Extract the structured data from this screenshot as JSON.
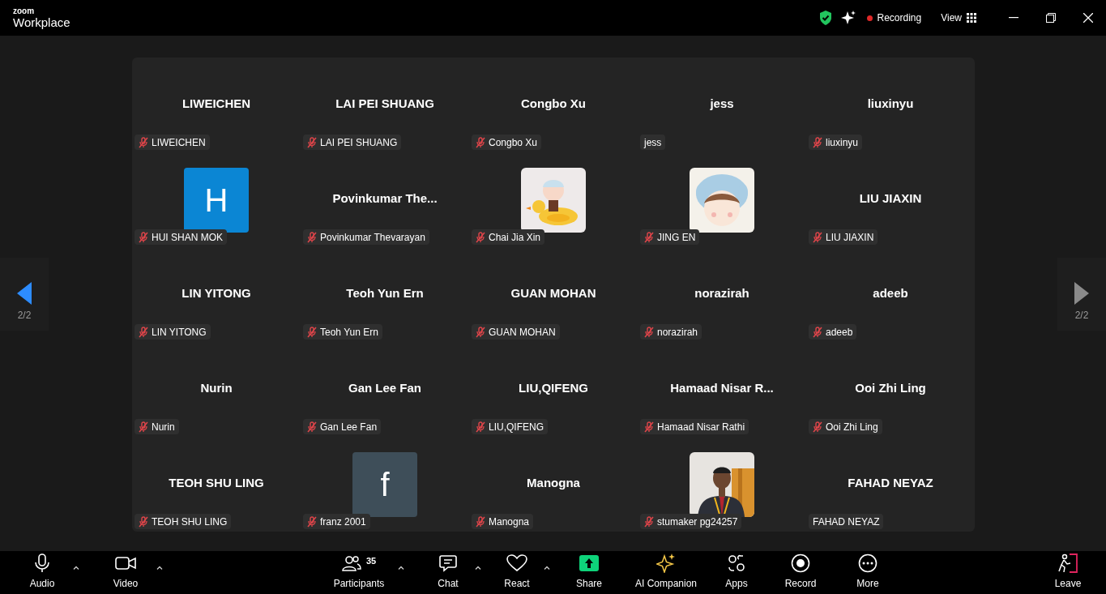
{
  "app": {
    "logo_top": "zoom",
    "logo_bottom": "Workplace"
  },
  "top_bar": {
    "recording": "Recording",
    "view": "View"
  },
  "pager": {
    "left": "2/2",
    "right": "2/2"
  },
  "tiles": [
    {
      "kind": "name",
      "name": "LIWEICHEN",
      "label": "LIWEICHEN",
      "muted": true
    },
    {
      "kind": "name",
      "name": "LAI PEI SHUANG",
      "label": "LAI PEI SHUANG",
      "muted": true
    },
    {
      "kind": "name",
      "name": "Congbo Xu",
      "label": "Congbo Xu",
      "muted": true
    },
    {
      "kind": "name",
      "name": "jess",
      "label": "jess",
      "muted": false
    },
    {
      "kind": "name",
      "name": "liuxinyu",
      "label": "liuxinyu",
      "muted": true
    },
    {
      "kind": "letter",
      "letter": "H",
      "color": "#0b86d4",
      "label": "HUI SHAN MOK",
      "muted": true
    },
    {
      "kind": "name",
      "name": "Povinkumar  The...",
      "label": "Povinkumar Thevarayan",
      "muted": true
    },
    {
      "kind": "picture",
      "label": "Chai Jia Xin",
      "muted": true
    },
    {
      "kind": "picture",
      "label": "JING EN",
      "muted": true
    },
    {
      "kind": "name",
      "name": "LIU JIAXIN",
      "label": "LIU JIAXIN",
      "muted": true
    },
    {
      "kind": "name",
      "name": "LIN YITONG",
      "label": "LIN YITONG",
      "muted": true
    },
    {
      "kind": "name",
      "name": "Teoh Yun Ern",
      "label": "Teoh Yun Ern",
      "muted": true
    },
    {
      "kind": "name",
      "name": "GUAN MOHAN",
      "label": "GUAN MOHAN",
      "muted": true
    },
    {
      "kind": "name",
      "name": "norazirah",
      "label": "norazirah",
      "muted": true
    },
    {
      "kind": "name",
      "name": "adeeb",
      "label": "adeeb",
      "muted": true
    },
    {
      "kind": "name",
      "name": "Nurin",
      "label": "Nurin",
      "muted": true
    },
    {
      "kind": "name",
      "name": "Gan Lee Fan",
      "label": "Gan Lee Fan",
      "muted": true
    },
    {
      "kind": "name",
      "name": "LIU,QIFENG",
      "label": "LIU,QIFENG",
      "muted": true
    },
    {
      "kind": "name",
      "name": "Hamaad  Nisar  R...",
      "label": "Hamaad Nisar Rathi",
      "muted": true
    },
    {
      "kind": "name",
      "name": "Ooi Zhi Ling",
      "label": "Ooi Zhi Ling",
      "muted": true
    },
    {
      "kind": "name",
      "name": "TEOH SHU LING",
      "label": "TEOH SHU LING",
      "muted": true
    },
    {
      "kind": "letter",
      "letter": "f",
      "color": "#3e4e59",
      "label": "franz 2001",
      "muted": true
    },
    {
      "kind": "name",
      "name": "Manogna",
      "label": "Manogna",
      "muted": true
    },
    {
      "kind": "picture",
      "label": "stumaker pg24257",
      "muted": true
    },
    {
      "kind": "name",
      "name": "FAHAD NEYAZ",
      "label": "FAHAD NEYAZ",
      "muted": false
    }
  ],
  "toolbar": [
    {
      "kind": "audio",
      "label": "Audio",
      "caret": true
    },
    {
      "kind": "video",
      "label": "Video",
      "caret": true
    },
    {
      "kind": "participants",
      "label": "Participants",
      "count": "35",
      "caret": true
    },
    {
      "kind": "chat",
      "label": "Chat",
      "caret": true
    },
    {
      "kind": "react",
      "label": "React",
      "caret": true
    },
    {
      "kind": "share",
      "label": "Share",
      "caret": false
    },
    {
      "kind": "ai",
      "label": "AI Companion",
      "caret": false
    },
    {
      "kind": "apps",
      "label": "Apps",
      "caret": false
    },
    {
      "kind": "record",
      "label": "Record",
      "caret": false
    },
    {
      "kind": "more",
      "label": "More",
      "caret": false
    },
    {
      "kind": "leave",
      "label": "Leave",
      "caret": false
    }
  ]
}
